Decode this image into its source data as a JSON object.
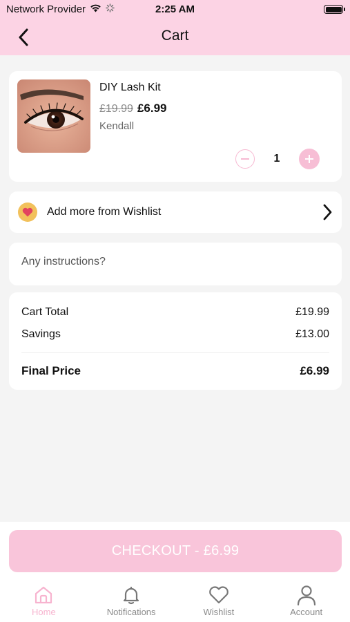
{
  "status_bar": {
    "carrier": "Network Provider",
    "time": "2:25 AM"
  },
  "nav": {
    "title": "Cart"
  },
  "product": {
    "name": "DIY Lash Kit",
    "old_price": "£19.99",
    "price": "£6.99",
    "brand": "Kendall",
    "quantity": "1"
  },
  "wishlist": {
    "label": "Add more from Wishlist"
  },
  "instructions": {
    "placeholder": "Any instructions?"
  },
  "summary": {
    "cart_total_label": "Cart Total",
    "cart_total_value": "£19.99",
    "savings_label": "Savings",
    "savings_value": "£13.00",
    "final_label": "Final Price",
    "final_value": "£6.99"
  },
  "checkout": {
    "label": "CHECKOUT - £6.99"
  },
  "tabs": [
    {
      "label": "Home",
      "icon": "home-icon",
      "active": true
    },
    {
      "label": "Notifications",
      "icon": "bell-icon",
      "active": false
    },
    {
      "label": "Wishlist",
      "icon": "heart-icon",
      "active": false
    },
    {
      "label": "Account",
      "icon": "user-icon",
      "active": false
    }
  ],
  "colors": {
    "accent_pink": "#fcd3e4",
    "button_pink": "#f9c5da",
    "active_tab": "#f7b3cf"
  }
}
